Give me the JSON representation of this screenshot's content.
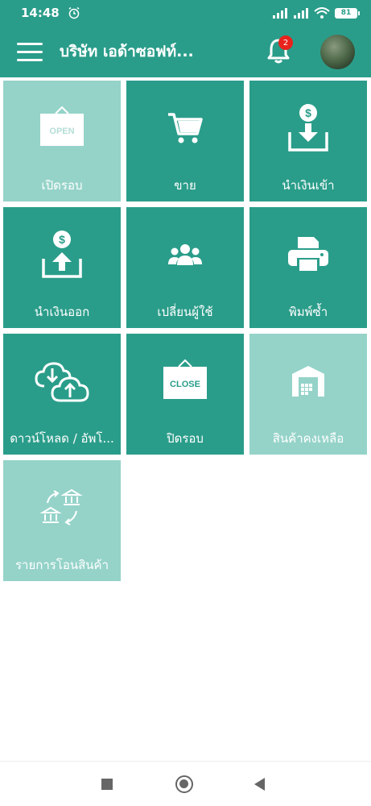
{
  "status_bar": {
    "time": "14:48",
    "battery": "81"
  },
  "app_bar": {
    "title": "บริษัท เอด้าซอฟท์...",
    "notification_count": "2"
  },
  "tiles": [
    {
      "label": "เปิดรอบ",
      "icon": "open-sign-icon",
      "icon_text": "OPEN",
      "active": false
    },
    {
      "label": "ขาย",
      "icon": "cart-icon",
      "active": true
    },
    {
      "label": "นำเงินเข้า",
      "icon": "money-in-icon",
      "active": true
    },
    {
      "label": "นำเงินออก",
      "icon": "money-out-icon",
      "active": true
    },
    {
      "label": "เปลี่ยนผู้ใช้",
      "icon": "users-icon",
      "active": true
    },
    {
      "label": "พิมพ์ซ้ำ",
      "icon": "printer-icon",
      "active": true
    },
    {
      "label": "ดาวน์โหลด / อัพโ...",
      "icon": "cloud-sync-icon",
      "active": true
    },
    {
      "label": "ปิดรอบ",
      "icon": "close-sign-icon",
      "icon_text": "CLOSE",
      "active": true
    },
    {
      "label": "สินค้าคงเหลือ",
      "icon": "warehouse-icon",
      "active": false
    },
    {
      "label": "รายการโอนสินค้า",
      "icon": "bank-transfer-icon",
      "active": false
    }
  ],
  "colors": {
    "primary": "#2a9d8a",
    "tile_light": "#95d3c9",
    "badge": "#e8231d"
  }
}
